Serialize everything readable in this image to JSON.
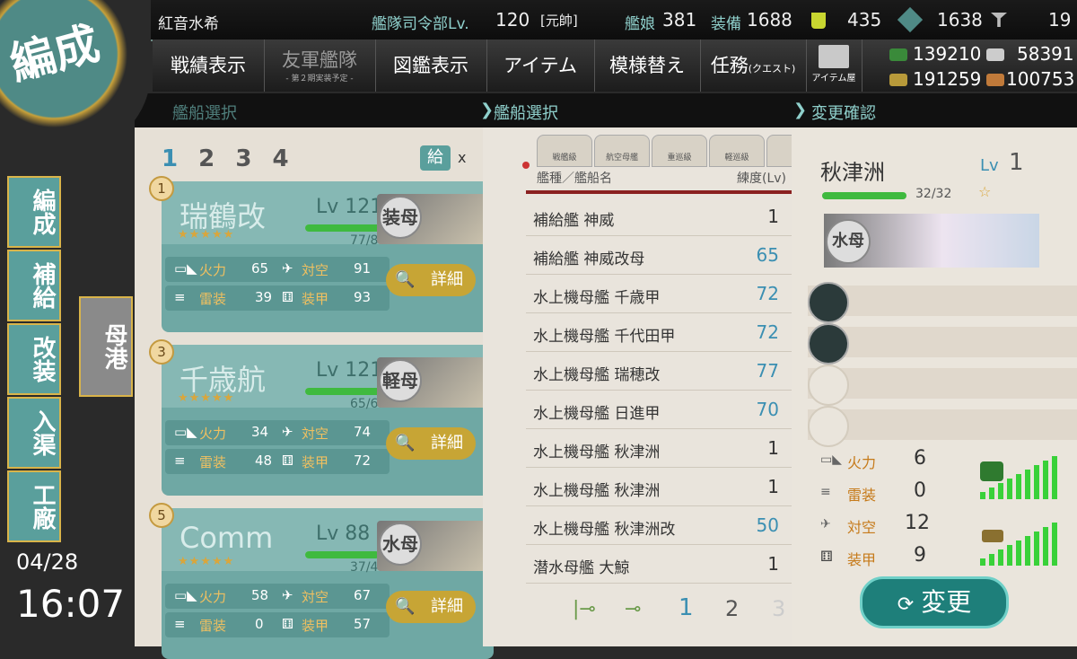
{
  "title_badge": "編成",
  "top": {
    "admiral_name": "紅音水希",
    "hq_label": "艦隊司令部Lv.",
    "hq_level": "120",
    "rank": "[元帥]",
    "ships_label": "艦娘",
    "ships": "381",
    "equip_label": "装備",
    "equip": "1688",
    "bucket": "435",
    "devmat": "1638",
    "screw": "19"
  },
  "menu": {
    "record": "戦績表示",
    "friend": "友軍艦隊",
    "friend_sub": "- 第２期実装予定 -",
    "library": "図鑑表示",
    "item": "アイテム",
    "interior": "模様替え",
    "quest": "任務",
    "quest_sub": "(クエスト)",
    "shop": "アイテム屋"
  },
  "resources": {
    "fuel": "139210",
    "steel": "58391",
    "ammo": "191259",
    "bauxite": "100753"
  },
  "sections": {
    "left": "艦船選択",
    "middle": "艦船選択",
    "right": "変更確認"
  },
  "fleet_tabs": [
    "1",
    "2",
    "3",
    "4"
  ],
  "supply_label": "給",
  "supply_x": "x",
  "slots": [
    {
      "num": "1",
      "name": "瑞鶴改",
      "lv_label": "Lv",
      "lv": "121",
      "hp": "77/87",
      "hp_pct": 0.885,
      "card_type": "装母",
      "fire_label": "火力",
      "fire": "65",
      "aa_label": "対空",
      "aa": "91",
      "torp_label": "雷装",
      "torp": "39",
      "armor_label": "装甲",
      "armor": "93",
      "detail": "詳細"
    },
    {
      "num": "3",
      "name": "千歳航",
      "lv_label": "Lv",
      "lv": "121",
      "hp": "65/65",
      "hp_pct": 1.0,
      "card_type": "軽母",
      "fire_label": "火力",
      "fire": "34",
      "aa_label": "対空",
      "aa": "74",
      "torp_label": "雷装",
      "torp": "48",
      "armor_label": "装甲",
      "armor": "72",
      "detail": "詳細"
    },
    {
      "num": "5",
      "name": "Comm",
      "lv_label": "Lv",
      "lv": "88",
      "hp": "37/43",
      "hp_pct": 0.86,
      "card_type": "水母",
      "fire_label": "火力",
      "fire": "58",
      "aa_label": "対空",
      "aa": "67",
      "torp_label": "雷装",
      "torp": "0",
      "armor_label": "装甲",
      "armor": "57",
      "detail": "詳細"
    }
  ],
  "side_nav": [
    "編成",
    "補給",
    "改装",
    "入渠",
    "工廠"
  ],
  "port_button": "母港",
  "clock": {
    "date": "04/28",
    "time": "16:07"
  },
  "list": {
    "tabs": [
      "戦艦級",
      "航空母艦",
      "重巡級",
      "軽巡級",
      ""
    ],
    "header_name": "艦種／艦船名",
    "header_level": "練度(Lv)",
    "rows": [
      {
        "name": "補給艦 神威",
        "lv": "1",
        "hi": false
      },
      {
        "name": "補給艦 神威改母",
        "lv": "65",
        "hi": true
      },
      {
        "name": "水上機母艦 千歳甲",
        "lv": "72",
        "hi": true
      },
      {
        "name": "水上機母艦 千代田甲",
        "lv": "72",
        "hi": true
      },
      {
        "name": "水上機母艦 瑞穂改",
        "lv": "77",
        "hi": true
      },
      {
        "name": "水上機母艦 日進甲",
        "lv": "70",
        "hi": true
      },
      {
        "name": "水上機母艦 秋津洲",
        "lv": "1",
        "hi": false
      },
      {
        "name": "水上機母艦 秋津洲",
        "lv": "1",
        "hi": false
      },
      {
        "name": "水上機母艦 秋津洲改",
        "lv": "50",
        "hi": true
      },
      {
        "name": "潜水母艦 大鯨",
        "lv": "1",
        "hi": false
      }
    ],
    "pages": [
      "1",
      "2",
      "3"
    ]
  },
  "confirm": {
    "name": "秋津洲",
    "lv_label": "Lv",
    "lv": "1",
    "hp": "32/32",
    "hp_pct": 1.0,
    "star": "☆",
    "card_type": "水母",
    "fire_label": "火力",
    "fire": "6",
    "torp_label": "雷装",
    "torp": "0",
    "aa_label": "対空",
    "aa": "12",
    "armor_label": "装甲",
    "armor": "9",
    "change_button": "変更"
  },
  "colors": {
    "accent": "#5a9f9c",
    "gold": "#c7a535",
    "hp": "#3fba3f"
  }
}
